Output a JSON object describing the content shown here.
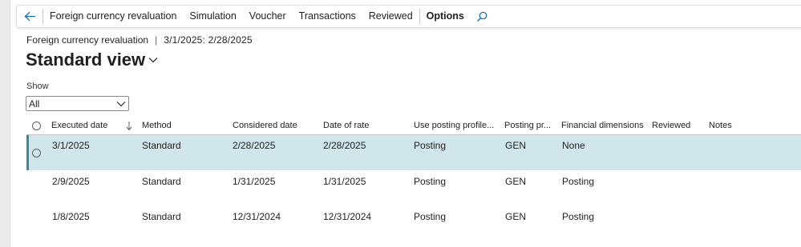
{
  "actionbar": {
    "items": [
      {
        "label": "Foreign currency revaluation",
        "bold": false
      },
      {
        "label": "Simulation",
        "bold": false
      },
      {
        "label": "Voucher",
        "bold": false
      },
      {
        "label": "Transactions",
        "bold": false
      },
      {
        "label": "Reviewed",
        "bold": false
      },
      {
        "label": "Options",
        "bold": true
      }
    ]
  },
  "breadcrumb": {
    "page": "Foreign currency revaluation",
    "separator": "|",
    "range": "3/1/2025: 2/28/2025"
  },
  "view": {
    "title": "Standard view"
  },
  "filter": {
    "label": "Show",
    "value": "All"
  },
  "grid": {
    "columns": {
      "executed_date": "Executed date",
      "method": "Method",
      "considered_date": "Considered date",
      "date_of_rate": "Date of rate",
      "use_posting_profile": "Use posting profile...",
      "posting_profile": "Posting pr...",
      "financial_dimensions": "Financial dimensions",
      "reviewed": "Reviewed",
      "notes": "Notes"
    },
    "rows": [
      {
        "executed_date": "3/1/2025",
        "method": "Standard",
        "considered_date": "2/28/2025",
        "date_of_rate": "2/28/2025",
        "use_posting_profile": "Posting",
        "posting_profile": "GEN",
        "financial_dimensions": "None",
        "reviewed": "",
        "notes": "",
        "selected": true
      },
      {
        "executed_date": "2/9/2025",
        "method": "Standard",
        "considered_date": "1/31/2025",
        "date_of_rate": "1/31/2025",
        "use_posting_profile": "Posting",
        "posting_profile": "GEN",
        "financial_dimensions": "Posting",
        "reviewed": "",
        "notes": "",
        "selected": false
      },
      {
        "executed_date": "1/8/2025",
        "method": "Standard",
        "considered_date": "12/31/2024",
        "date_of_rate": "12/31/2024",
        "use_posting_profile": "Posting",
        "posting_profile": "GEN",
        "financial_dimensions": "Posting",
        "reviewed": "",
        "notes": "",
        "selected": false
      }
    ]
  },
  "colors": {
    "accent": "#0f6cbd",
    "selected_row": "#d1e6ea",
    "selected_marker": "#3a8a9e"
  }
}
